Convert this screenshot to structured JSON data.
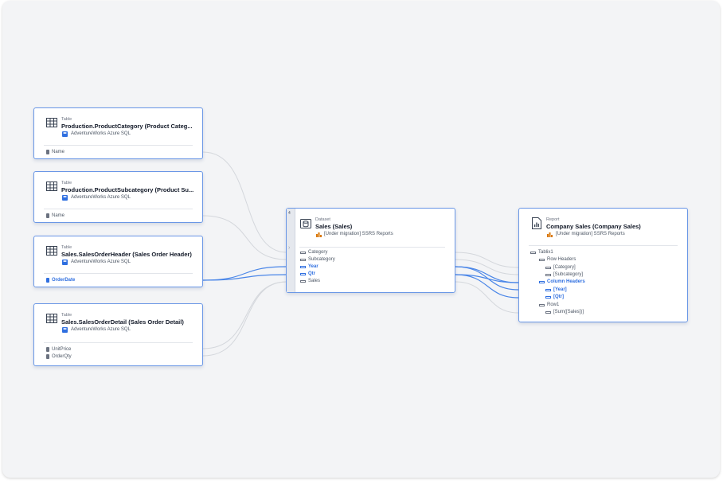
{
  "tables": [
    {
      "kind": "Table",
      "title": "Production.ProductCategory (Product Categ...",
      "source": "AdventureWorks Azure SQL",
      "fields": [
        {
          "label": "Name",
          "highlighted": false
        }
      ]
    },
    {
      "kind": "Table",
      "title": "Production.ProductSubcategory (Product Su...",
      "source": "AdventureWorks Azure SQL",
      "fields": [
        {
          "label": "Name",
          "highlighted": false
        }
      ]
    },
    {
      "kind": "Table",
      "title": "Sales.SalesOrderHeader (Sales Order Header)",
      "source": "AdventureWorks Azure SQL",
      "fields": [
        {
          "label": "OrderDate",
          "highlighted": true
        }
      ]
    },
    {
      "kind": "Table",
      "title": "Sales.SalesOrderDetail (Sales Order Detail)",
      "source": "AdventureWorks Azure SQL",
      "fields": [
        {
          "label": "UnitPrice",
          "highlighted": false
        },
        {
          "label": "OrderQty",
          "highlighted": false
        }
      ]
    }
  ],
  "dataset": {
    "badge": "4",
    "kind": "Dataset",
    "title": "Sales (Sales)",
    "source": "[Under migration] SSRS Reports",
    "fields": [
      {
        "label": "Category",
        "highlighted": false
      },
      {
        "label": "Subcategory",
        "highlighted": false
      },
      {
        "label": "Year",
        "highlighted": true
      },
      {
        "label": "Qtr",
        "highlighted": true
      },
      {
        "label": "Sales",
        "highlighted": false
      }
    ]
  },
  "report": {
    "kind": "Report",
    "title": "Company Sales (Company Sales)",
    "source": "[Under migration] SSRS Reports",
    "tree": [
      {
        "label": "Tablix1",
        "level": 0,
        "highlighted": false
      },
      {
        "label": "Row Headers",
        "level": 1,
        "highlighted": false
      },
      {
        "label": "[Category]",
        "level": 2,
        "highlighted": false
      },
      {
        "label": "[Subcategory]",
        "level": 2,
        "highlighted": false
      },
      {
        "label": "Column Headers",
        "level": 1,
        "highlighted": true
      },
      {
        "label": "[Year]",
        "level": 2,
        "highlighted": true
      },
      {
        "label": "[Qtr]",
        "level": 2,
        "highlighted": true
      },
      {
        "label": "Row1",
        "level": 1,
        "highlighted": false
      },
      {
        "label": "[Sum([Sales])]",
        "level": 2,
        "highlighted": false
      }
    ]
  },
  "colors": {
    "accent": "#2f6fe0",
    "link": "#d4d7dc",
    "highlight_link": "#4a86e8"
  }
}
